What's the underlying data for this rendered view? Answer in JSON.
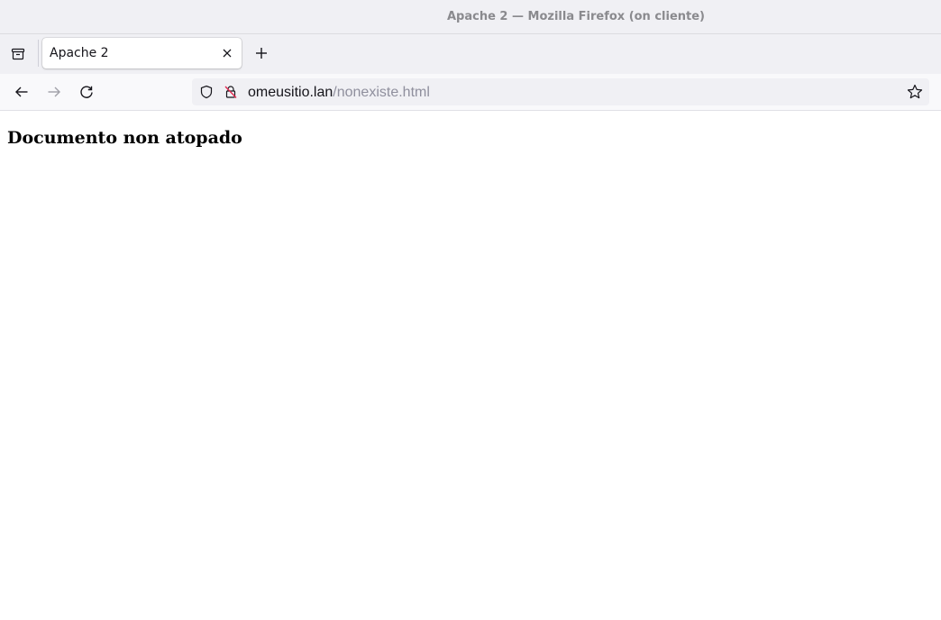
{
  "window": {
    "title": "Apache 2 — Mozilla Firefox (on cliente)"
  },
  "tabs": [
    {
      "label": "Apache 2",
      "active": true
    }
  ],
  "toolbar": {
    "list_tabs_icon": "tab-list-icon",
    "new_tab_icon": "plus-icon",
    "back_icon": "back-arrow-icon",
    "forward_icon": "forward-arrow-icon",
    "reload_icon": "reload-icon"
  },
  "urlbar": {
    "host": "omeusitio.lan",
    "path": "/nonexiste.html",
    "tracking_icon": "shield-icon",
    "security_icon": "insecure-lock-icon",
    "bookmark_icon": "star-icon"
  },
  "page": {
    "heading": "Documento non atopado"
  },
  "colors": {
    "chrome_bg": "#f0f0f4",
    "navbar_bg": "#f9f9fb",
    "insecure_red": "#e22850"
  }
}
